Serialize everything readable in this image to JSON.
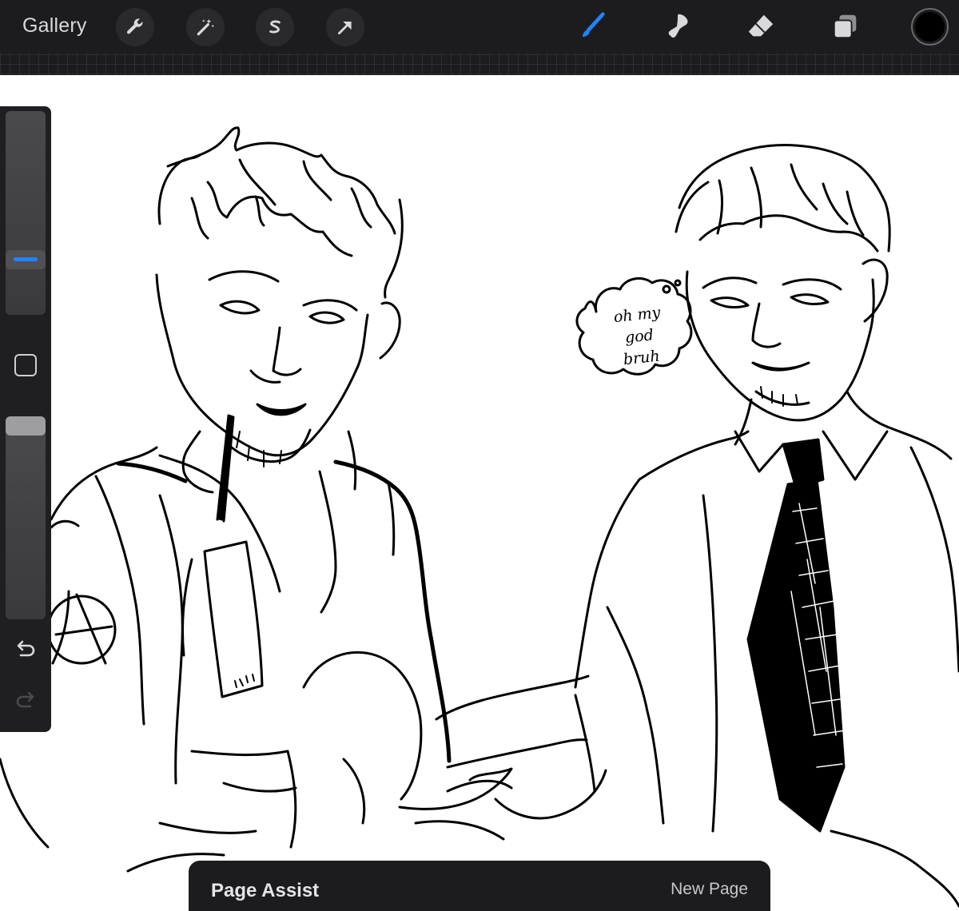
{
  "toolbar": {
    "gallery_label": "Gallery",
    "left_tools": [
      {
        "name": "actions",
        "icon": "wrench-icon"
      },
      {
        "name": "adjustments",
        "icon": "magic-wand-icon"
      },
      {
        "name": "selection",
        "icon": "selection-s-icon"
      },
      {
        "name": "transform",
        "icon": "arrow-cursor-icon"
      }
    ],
    "right_tools": [
      {
        "name": "brush",
        "icon": "brush-icon",
        "active": true
      },
      {
        "name": "smudge",
        "icon": "smudge-finger-icon",
        "active": false
      },
      {
        "name": "eraser",
        "icon": "eraser-icon",
        "active": false
      },
      {
        "name": "layers",
        "icon": "layers-icon",
        "active": false
      }
    ],
    "current_color": "#000000",
    "active_color": "#1f84ff"
  },
  "sidebar": {
    "brush_size_level": 0.72,
    "opacity_level": 1.0,
    "modify_icon": "square-icon",
    "undo_icon": "undo-icon",
    "redo_icon": "redo-icon"
  },
  "canvas": {
    "sketch_text": [
      "oh my",
      "god",
      "bruh"
    ]
  },
  "page_assist": {
    "title": "Page Assist",
    "new_page_label": "New Page"
  }
}
